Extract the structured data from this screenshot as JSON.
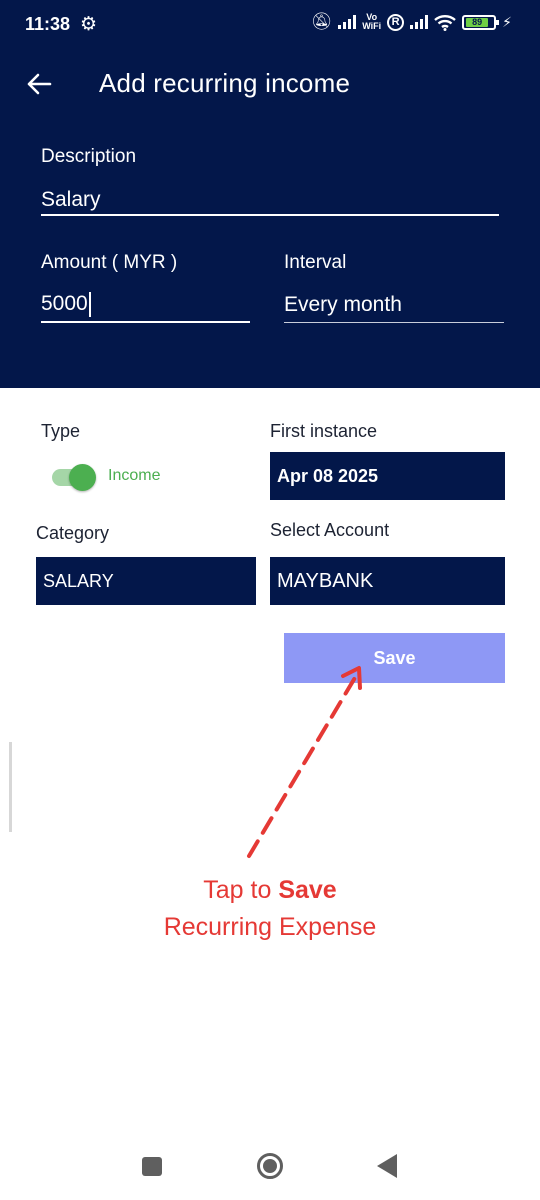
{
  "status_bar": {
    "time": "11:38",
    "volte_top": "Vo",
    "volte_bottom": "WiFi",
    "roaming": "R",
    "battery": "89"
  },
  "header": {
    "title": "Add recurring income"
  },
  "form": {
    "description_label": "Description",
    "description_value": "Salary",
    "amount_label": "Amount ( MYR )",
    "amount_value": "5000",
    "interval_label": "Interval",
    "interval_value": "Every month",
    "type_label": "Type",
    "type_toggle_label": "Income",
    "type_toggle_on": true,
    "first_instance_label": "First instance",
    "first_instance_value": "Apr 08 2025",
    "category_label": "Category",
    "category_value": "SALARY",
    "account_label": "Select Account",
    "account_value": "MAYBANK",
    "save_label": "Save"
  },
  "annotation": {
    "line1_prefix": "Tap to ",
    "line1_bold": "Save",
    "line2": "Recurring Expense"
  },
  "colors": {
    "header_bg": "#03174a",
    "save_button": "#8e98f5",
    "toggle_on": "#4caf50",
    "annotation": "#e53935"
  }
}
